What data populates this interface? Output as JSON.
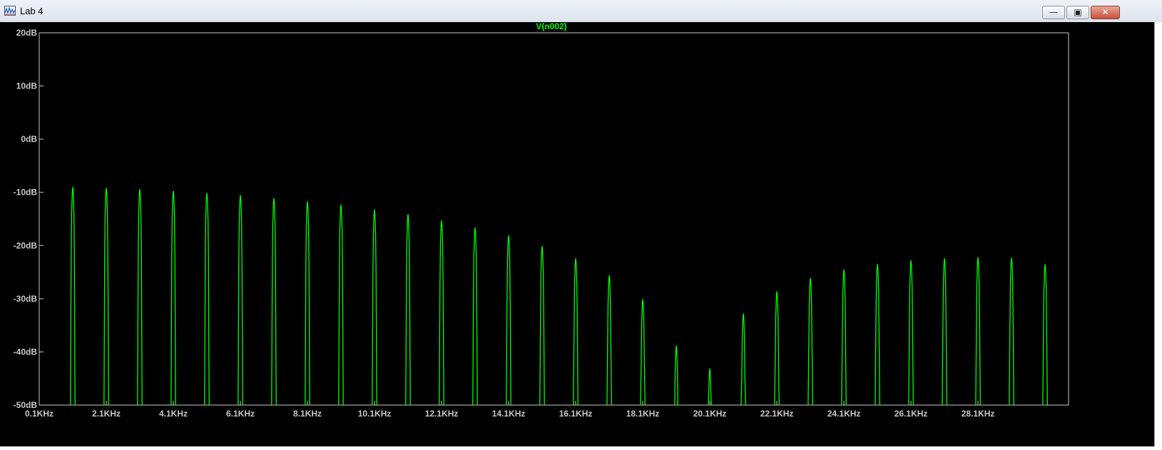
{
  "window": {
    "title": "Lab 4",
    "minimize_glyph": "—",
    "maximize_glyph": "▣",
    "close_glyph": "✕"
  },
  "colors": {
    "background": "#000000",
    "trace": "#00ff00",
    "axis_text": "#c8c8c8",
    "frame": "#c8c8c8"
  },
  "chart_data": {
    "type": "line",
    "title": "V(n002)",
    "xlabel": "",
    "ylabel": "",
    "xlim": [
      0.1,
      30.8
    ],
    "ylim": [
      -50,
      20
    ],
    "x_unit": "KHz",
    "y_unit": "dB",
    "grid": false,
    "x_tick_values": [
      0.1,
      2.1,
      4.1,
      6.1,
      8.1,
      10.1,
      12.1,
      14.1,
      16.1,
      18.1,
      20.1,
      22.1,
      24.1,
      26.1,
      28.1
    ],
    "x_tick_labels": [
      "0.1KHz",
      "2.1KHz",
      "4.1KHz",
      "6.1KHz",
      "8.1KHz",
      "10.1KHz",
      "12.1KHz",
      "14.1KHz",
      "16.1KHz",
      "18.1KHz",
      "20.1KHz",
      "22.1KHz",
      "24.1KHz",
      "26.1KHz",
      "28.1KHz"
    ],
    "y_tick_values": [
      20,
      10,
      0,
      -10,
      -20,
      -30,
      -40,
      -50
    ],
    "y_tick_labels": [
      "20dB",
      "10dB",
      "0dB",
      "-10dB",
      "-20dB",
      "-30dB",
      "-40dB",
      "-50dB"
    ],
    "series": [
      {
        "name": "V(n002)",
        "peak_x_khz": [
          1.1,
          2.1,
          3.1,
          4.1,
          5.1,
          6.1,
          7.1,
          8.1,
          9.1,
          10.1,
          11.1,
          12.1,
          13.1,
          14.1,
          15.1,
          16.1,
          17.1,
          18.1,
          19.1,
          20.1,
          21.1,
          22.1,
          23.1,
          24.1,
          25.1,
          26.1,
          27.1,
          28.1,
          29.1,
          30.1
        ],
        "peak_db": [
          -9,
          -9.2,
          -9.4,
          -9.7,
          -10.1,
          -10.5,
          -11.1,
          -11.7,
          -12.3,
          -13.2,
          -14.1,
          -15.3,
          -16.6,
          -18.1,
          -20.1,
          -22.4,
          -25.6,
          -30.1,
          -38.8,
          -43.1,
          -32.8,
          -28.6,
          -26.1,
          -24.5,
          -23.5,
          -22.8,
          -22.4,
          -22.2,
          -22.3,
          -23.5
        ]
      }
    ]
  }
}
